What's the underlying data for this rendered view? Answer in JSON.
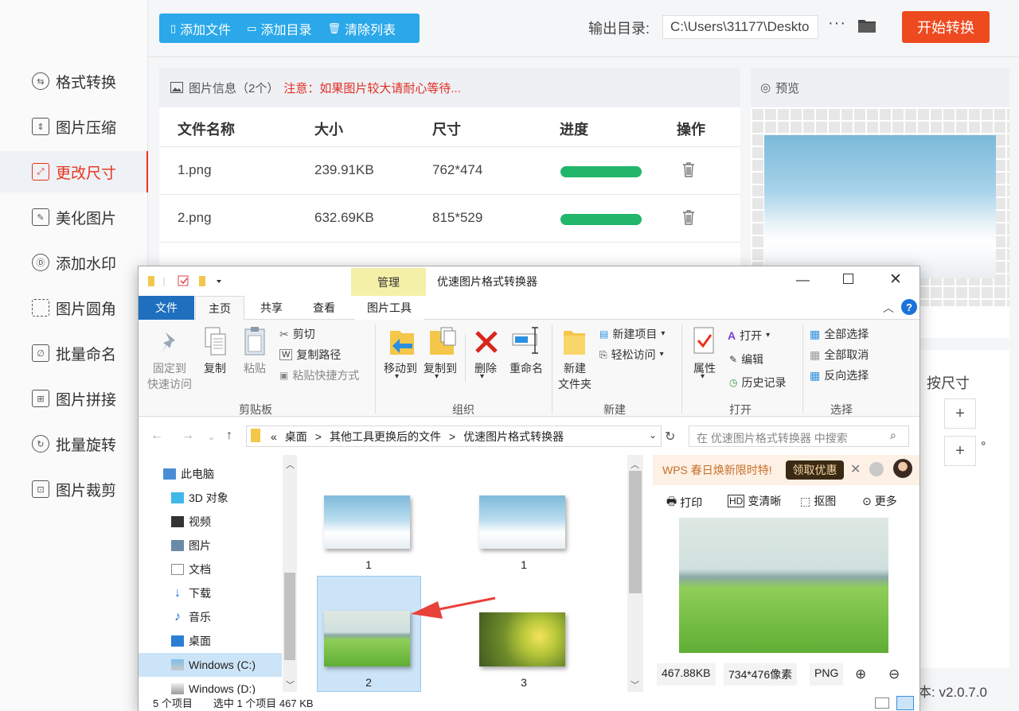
{
  "sidebar": {
    "items": [
      {
        "label": "格式转换",
        "icon": "format-convert-icon"
      },
      {
        "label": "图片压缩",
        "icon": "compress-icon"
      },
      {
        "label": "更改尺寸",
        "icon": "resize-icon",
        "active": true
      },
      {
        "label": "美化图片",
        "icon": "beautify-icon"
      },
      {
        "label": "添加水印",
        "icon": "watermark-icon"
      },
      {
        "label": "图片圆角",
        "icon": "round-corner-icon"
      },
      {
        "label": "批量命名",
        "icon": "rename-icon"
      },
      {
        "label": "图片拼接",
        "icon": "stitch-icon"
      },
      {
        "label": "批量旋转",
        "icon": "rotate-icon"
      },
      {
        "label": "图片裁剪",
        "icon": "crop-icon"
      }
    ]
  },
  "toolbar": {
    "add_file": "添加文件",
    "add_dir": "添加目录",
    "clear_list": "清除列表",
    "output_label": "输出目录:",
    "output_path": "C:\\Users\\31177\\Deskto",
    "more": "···",
    "start": "开始转换"
  },
  "colors": {
    "accent": "#ee4a1f",
    "blue": "#2aa8e9",
    "progress": "#21b66a",
    "active_text": "#e8341c"
  },
  "info": {
    "title": "图片信息（2个）",
    "warning": "注意：如果图片较大请耐心等待...",
    "columns": [
      "文件名称",
      "大小",
      "尺寸",
      "进度",
      "操作"
    ],
    "rows": [
      {
        "name": "1.png",
        "size": "239.91KB",
        "dims": "762*474",
        "progress": 1.0
      },
      {
        "name": "2.png",
        "size": "632.69KB",
        "dims": "815*529",
        "progress": 1.0
      }
    ]
  },
  "preview": {
    "title": "预览"
  },
  "resize": {
    "by_size": "按尺寸",
    "plus": "+",
    "degree": "°"
  },
  "version": "本: v2.0.7.0",
  "explorer": {
    "tab_manage": "管理",
    "window_title": "优速图片格式转换器",
    "tabs": {
      "file": "文件",
      "home": "主页",
      "share": "共享",
      "view": "查看",
      "picture_tools": "图片工具"
    },
    "ribbon": {
      "pin": "固定到\n快速访问",
      "copy": "复制",
      "paste": "粘贴",
      "cut": "剪切",
      "copy_path": "复制路径",
      "paste_shortcut": "粘贴快捷方式",
      "group_clipboard": "剪贴板",
      "move_to": "移动到",
      "copy_to": "复制到",
      "delete": "删除",
      "rename": "重命名",
      "group_organize": "组织",
      "new_folder": "新建\n文件夹",
      "new_item": "新建项目",
      "easy_access": "轻松访问",
      "group_new": "新建",
      "properties": "属性",
      "open": "打开",
      "edit": "编辑",
      "history": "历史记录",
      "group_open": "打开",
      "select_all": "全部选择",
      "select_none": "全部取消",
      "invert": "反向选择",
      "group_select": "选择"
    },
    "breadcrumb": [
      "«",
      "桌面",
      ">",
      "其他工具更换后的文件",
      ">",
      "优速图片格式转换器"
    ],
    "search_placeholder": "在 优速图片格式转换器 中搜索",
    "tree": [
      {
        "label": "此电脑",
        "icon": "pc-icon"
      },
      {
        "label": "3D 对象",
        "icon": "3d-objects-icon"
      },
      {
        "label": "视频",
        "icon": "video-icon"
      },
      {
        "label": "图片",
        "icon": "pictures-icon"
      },
      {
        "label": "文档",
        "icon": "documents-icon"
      },
      {
        "label": "下载",
        "icon": "download-icon"
      },
      {
        "label": "音乐",
        "icon": "music-icon"
      },
      {
        "label": "桌面",
        "icon": "desktop-icon"
      },
      {
        "label": "Windows (C:)",
        "icon": "drive-c-icon",
        "selected": true
      },
      {
        "label": "Windows (D:)",
        "icon": "drive-d-icon"
      }
    ],
    "files": [
      {
        "name": "1"
      },
      {
        "name": "1"
      },
      {
        "name": "2",
        "selected": true
      },
      {
        "name": "3"
      }
    ],
    "wps_ad": "WPS 春日焕新限时特!",
    "wps_button": "领取优惠",
    "preview_actions": [
      "打印",
      "变清晰",
      "抠图",
      "更多"
    ],
    "preview_stats": [
      "467.88KB",
      "734*476像素",
      "PNG"
    ],
    "status_items": "5 个项目",
    "status_selected": "选中 1 个项目  467 KB"
  }
}
